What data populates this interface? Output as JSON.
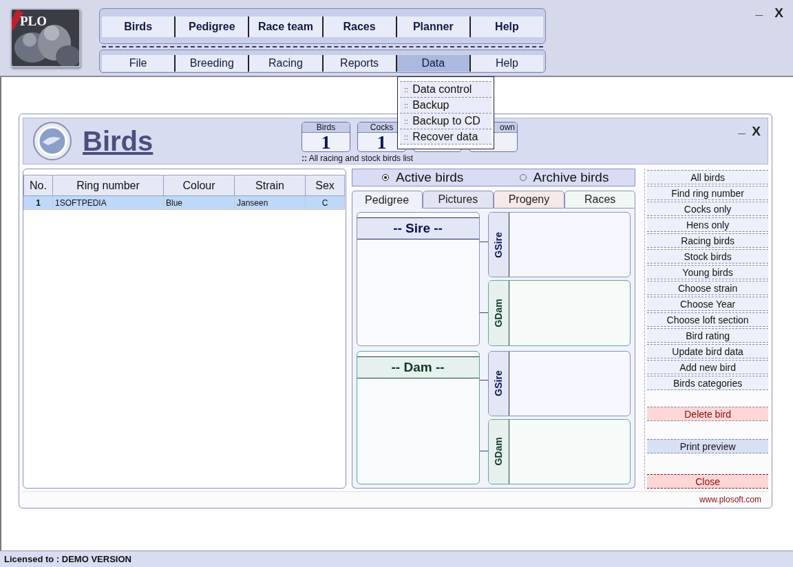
{
  "logo": {
    "text": "PLO"
  },
  "main_menu": [
    {
      "label": "Birds"
    },
    {
      "label": "Pedigree"
    },
    {
      "label": "Race team"
    },
    {
      "label": "Races"
    },
    {
      "label": "Planner"
    },
    {
      "label": "Help"
    }
  ],
  "sub_menu": [
    {
      "label": "File",
      "selected": false
    },
    {
      "label": "Breeding",
      "selected": false
    },
    {
      "label": "Racing",
      "selected": false
    },
    {
      "label": "Reports",
      "selected": false
    },
    {
      "label": "Data",
      "selected": true
    },
    {
      "label": "Help",
      "selected": false
    }
  ],
  "window_controls": {
    "minimize": "_",
    "close": "X"
  },
  "dropdown": [
    {
      "marker": "::",
      "label": "Data control"
    },
    {
      "marker": "::",
      "label": "Backup"
    },
    {
      "marker": "::",
      "label": "Backup to CD"
    },
    {
      "marker": "::",
      "label": "Recover data"
    }
  ],
  "birds_window": {
    "title": "Birds",
    "minimize": "_",
    "close": "X",
    "counters": [
      {
        "kind": "counter",
        "label": "Birds",
        "value": "1"
      },
      {
        "kind": "counter",
        "label": "Cocks",
        "value": "1"
      },
      {
        "kind": "counter"
      },
      {
        "kind": "counter",
        "label": "own"
      }
    ],
    "subtitle_marker": "::",
    "subtitle": "All racing and stock birds list"
  },
  "table": {
    "columns": [
      "No.",
      "Ring number",
      "Colour",
      "Strain",
      "Sex"
    ],
    "rows": [
      {
        "cells": [
          "1",
          "1SOFTPEDIA",
          "Blue",
          "Janseen",
          "C"
        ],
        "selected": true
      }
    ]
  },
  "filter": [
    {
      "label": "Active birds",
      "selected": true
    },
    {
      "label": "Archive birds",
      "selected": false
    }
  ],
  "tabs": [
    {
      "label": "Pedigree",
      "selected": true,
      "color": "#eef1fb"
    },
    {
      "label": "Pictures",
      "selected": false,
      "color": "#e2e4f2"
    },
    {
      "label": "Progeny",
      "selected": false,
      "color": "#f7e9e7"
    },
    {
      "label": "Races",
      "selected": false,
      "color": "#f1f7f5"
    }
  ],
  "pedigree": [
    {
      "kind": "sire",
      "title": "-- Sire --",
      "grandparents": [
        {
          "kind": "sire",
          "label": "GSire"
        },
        {
          "kind": "dam",
          "label": "GDam"
        }
      ]
    },
    {
      "kind": "dam",
      "title": "-- Dam --",
      "grandparents": [
        {
          "kind": "sire",
          "label": "GSire"
        },
        {
          "kind": "dam",
          "label": "GDam"
        }
      ]
    }
  ],
  "actions": [
    {
      "label": "All birds",
      "kind": "normal"
    },
    {
      "label": "Find ring number",
      "kind": "normal"
    },
    {
      "label": "Cocks only",
      "kind": "normal"
    },
    {
      "label": "Hens only",
      "kind": "normal"
    },
    {
      "label": "Racing birds",
      "kind": "normal"
    },
    {
      "label": "Stock birds",
      "kind": "normal"
    },
    {
      "label": "Young birds",
      "kind": "normal"
    },
    {
      "label": "Choose strain",
      "kind": "normal"
    },
    {
      "label": "Choose Year",
      "kind": "normal"
    },
    {
      "label": "Choose loft section",
      "kind": "normal"
    },
    {
      "label": "Bird rating",
      "kind": "normal"
    },
    {
      "label": "Update bird data",
      "kind": "normal"
    },
    {
      "label": "Add new bird",
      "kind": "normal"
    },
    {
      "label": "Birds categories",
      "kind": "normal"
    },
    {
      "label": "Delete bird",
      "kind": "danger"
    },
    {
      "label": "Print preview",
      "kind": "print"
    },
    {
      "label": "Close",
      "kind": "close"
    }
  ],
  "footer_link": "www.plosoft.com",
  "status_bar": "Licensed to : DEMO VERSION"
}
